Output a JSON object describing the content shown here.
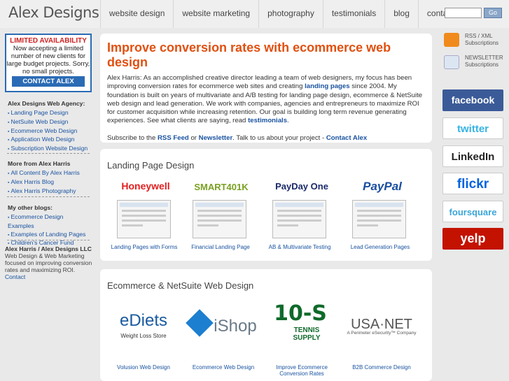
{
  "brand": {
    "name": "Alex Designs"
  },
  "nav": {
    "items": [
      "website design",
      "website marketing",
      "photography",
      "testimonials",
      "blog",
      "contact"
    ],
    "search_button": "Go"
  },
  "promo": {
    "heading": "LIMITED AVAILABILITY",
    "text": "Now accepting a limited number of new clients for large budget projects. Sorry, no small projects.",
    "button": "CONTACT ALEX"
  },
  "left": {
    "agency_heading": "Alex Designs Web Agency:",
    "agency_links": [
      "Landing Page Design",
      "NetSuite Web Design",
      "Ecommerce Web Design",
      "Application Web Design",
      "Subscription Website Design"
    ],
    "more_heading": "More from Alex Harris",
    "more_links": [
      "All Content By Alex Harris",
      "Alex Harris Blog",
      "Alex Harris Photography"
    ],
    "blogs_heading": "My other blogs:",
    "blogs_links": [
      "Ecommerce Design Examples",
      "Examples of Landing Pages",
      "Children's Cancer Fund"
    ],
    "llc_title": "Alex Harris / Alex Designs LLC",
    "llc_text": "Web Design & Web Marketing focused on improving conversion rates and maximizing ROI.",
    "llc_contact": "Contact"
  },
  "main": {
    "title": "Improve conversion rates with ecommerce web design",
    "p1a": "Alex Harris: As an accomplished creative director leading a team of web designers, my focus has been improving conversion rates for ecommerce web sites and creating ",
    "p1_link1": "landing pages",
    "p1b": " since 2004. My foundation is built on years of multivariate and A/B testing for landing page design, ecommerce & NetSuite web design and lead generation. We work with companies, agencies and entrepreneurs to maximize ROI for customer acquisition while increasing retention. Our goal is building long term revenue generating experiences. See what clients are saying, read ",
    "p1_link2": "testimonials",
    "p1c": ".",
    "sub_a": "Subscribe to the ",
    "sub_rss": "RSS Feed",
    "sub_or": " or ",
    "sub_news": "Newsletter",
    "sub_b": ". Talk to us about your project - ",
    "sub_contact": "Contact Alex"
  },
  "landing": {
    "heading": "Landing Page Design",
    "items": [
      {
        "logo": "Honeywell",
        "label": "Landing Pages with Forms",
        "color": "#e02020"
      },
      {
        "logo": "SMART401K",
        "label": "Financial Landing Page",
        "color": "#7aa020"
      },
      {
        "logo": "PayDay One",
        "label": "AB & Multivariate Testing",
        "color": "#1a2a6a"
      },
      {
        "logo": "PayPal",
        "label": "Lead Generation Pages",
        "color": "#1a4fa0"
      }
    ]
  },
  "ecommerce": {
    "heading": "Ecommerce & NetSuite Web Design",
    "items": [
      {
        "logo": "eDiets",
        "sublogo": "Weight Loss Store",
        "label": "Volusion Web Design",
        "color": "#1a5aa0"
      },
      {
        "logo": "iShop",
        "sublogo": "",
        "label": "Ecommerce Web Design",
        "color": "#6a7a88"
      },
      {
        "logo": "10-S",
        "sublogo": "TENNIS SUPPLY",
        "label": "Improve Ecommerce Conversion Rates",
        "color": "#0f6a2a"
      },
      {
        "logo": "USA·NET",
        "sublogo": "A Perimeter eSecurity™ Company",
        "label": "B2B Commerce Design",
        "color": "#555"
      }
    ]
  },
  "right": {
    "rss": "RSS / XML",
    "rss_sub": "Subscriptions",
    "news": "NEWSLETTER",
    "news_sub": "Subscriptions",
    "social": [
      "facebook",
      "twitter",
      "LinkedIn",
      "flickr",
      "foursquare",
      "yelp"
    ]
  }
}
